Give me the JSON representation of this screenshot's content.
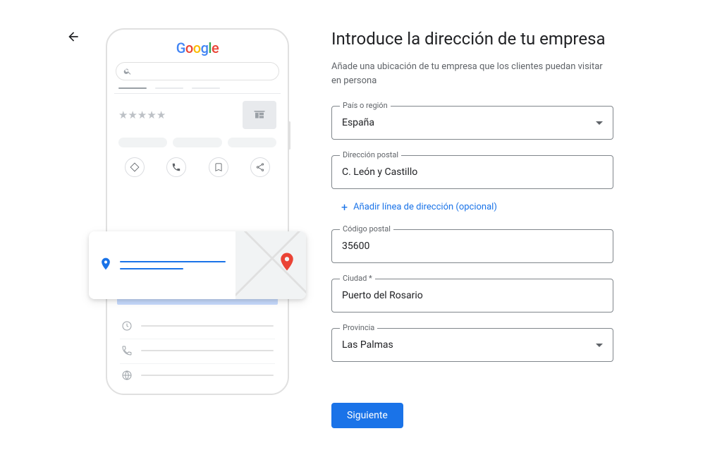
{
  "heading": "Introduce la dirección de tu empresa",
  "subtitle": "Añade una ubicación de tu empresa que los clientes puedan visitar en persona",
  "logo_letters": [
    "G",
    "o",
    "o",
    "g",
    "l",
    "e"
  ],
  "form": {
    "country_label": "País o región",
    "country_value": "España",
    "address_label": "Dirección postal",
    "address_value": "C. León y Castillo",
    "add_line_label": "Añadir línea de dirección (opcional)",
    "postal_label": "Código postal",
    "postal_value": "35600",
    "city_label": "Ciudad *",
    "city_value": "Puerto del Rosario",
    "province_label": "Provincia",
    "province_value": "Las Palmas",
    "next_label": "Siguiente"
  }
}
